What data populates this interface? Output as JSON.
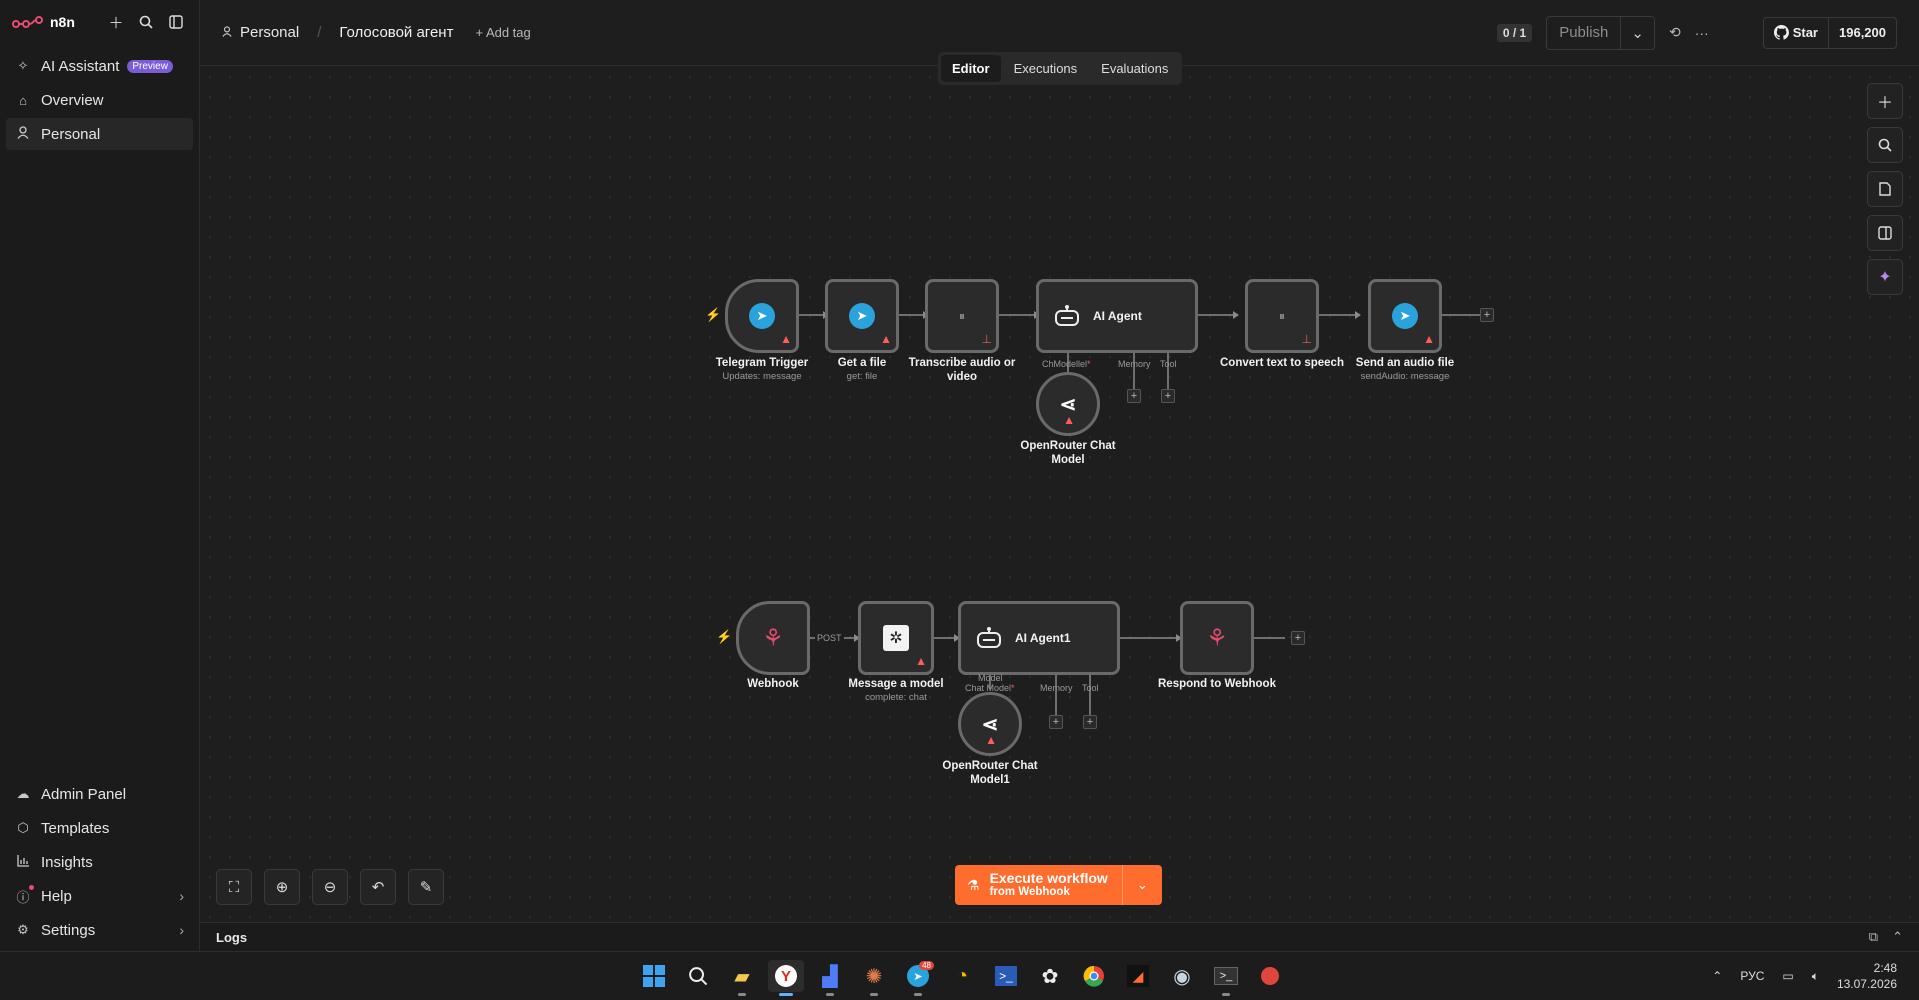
{
  "app": {
    "name": "n8n"
  },
  "sidebar": {
    "items": [
      {
        "label": "AI Assistant",
        "badge": "Preview"
      },
      {
        "label": "Overview"
      },
      {
        "label": "Personal"
      }
    ],
    "bottom": [
      {
        "label": "Admin Panel"
      },
      {
        "label": "Templates"
      },
      {
        "label": "Insights"
      },
      {
        "label": "Help"
      },
      {
        "label": "Settings"
      }
    ]
  },
  "header": {
    "project": "Personal",
    "workflow_name": "Голосовой агент",
    "add_tag": "+ Add tag",
    "counter": "0 / 1",
    "publish": "Publish",
    "github_star": "Star",
    "github_count": "196,200"
  },
  "tabs": [
    "Editor",
    "Executions",
    "Evaluations"
  ],
  "workflow1": {
    "nodes": [
      {
        "name": "Telegram Trigger",
        "sub": "Updates: message"
      },
      {
        "name": "Get a file",
        "sub": "get: file"
      },
      {
        "name": "Transcribe audio or video",
        "sub": ""
      },
      {
        "name": "AI Agent",
        "sub": ""
      },
      {
        "name": "Convert text to speech",
        "sub": ""
      },
      {
        "name": "Send an audio file",
        "sub": "sendAudio: message"
      },
      {
        "name": "OpenRouter Chat Model",
        "sub": ""
      }
    ],
    "handles": {
      "chat_model": "ChModellel",
      "memory": "Memory",
      "tool": "Tool"
    }
  },
  "workflow2": {
    "nodes": [
      {
        "name": "Webhook",
        "sub": ""
      },
      {
        "name": "Message a model",
        "sub": "complete: chat"
      },
      {
        "name": "AI Agent1",
        "sub": ""
      },
      {
        "name": "Respond to Webhook",
        "sub": ""
      },
      {
        "name": "OpenRouter Chat Model1",
        "sub": ""
      }
    ],
    "edge_label": "POST",
    "handles": {
      "chat_model_1": "Model",
      "chat_model_2": "Chat Model",
      "memory": "Memory",
      "tool": "Tool"
    }
  },
  "execute": {
    "line1": "Execute workflow",
    "line2": "from Webhook"
  },
  "logs": {
    "label": "Logs"
  },
  "taskbar": {
    "lang": "РУС",
    "time": "2:48",
    "date": "13.07.2026",
    "telegram_badge": "48"
  },
  "colors": {
    "accent": "#ff6d2e",
    "brand": "#ea4b71",
    "telegram": "#2aa3dc",
    "ai": "#b886f6"
  }
}
